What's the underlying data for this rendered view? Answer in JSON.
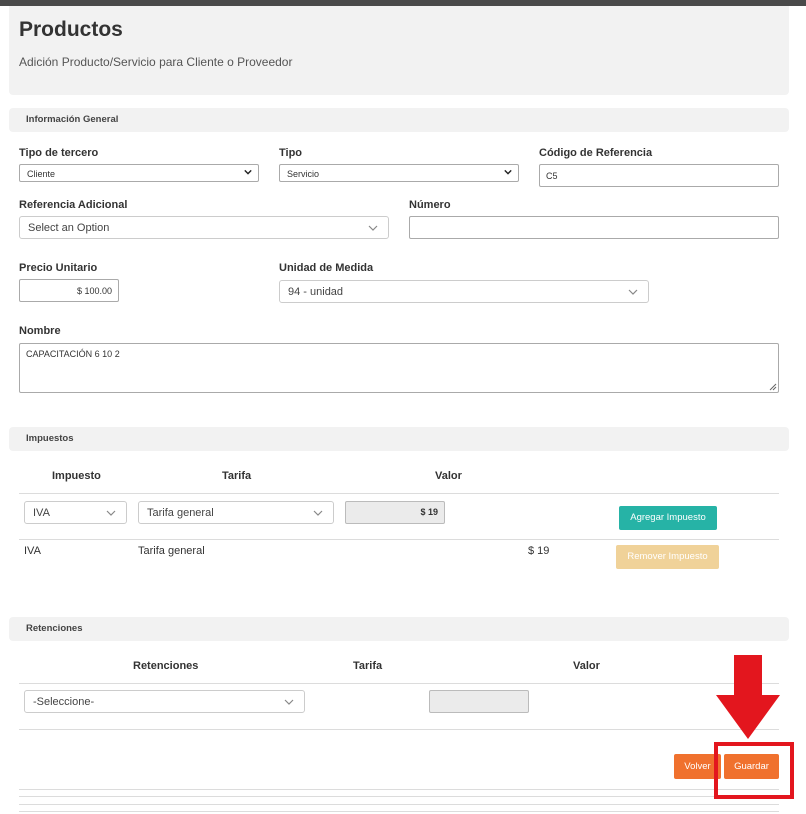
{
  "header": {
    "title": "Productos",
    "subtitle": "Adición Producto/Servicio para Cliente o Proveedor"
  },
  "general": {
    "section_title": "Información General",
    "tipo_tercero": {
      "label": "Tipo de tercero",
      "value": "Cliente"
    },
    "tipo": {
      "label": "Tipo",
      "value": "Servicio"
    },
    "codigo_referencia": {
      "label": "Código de Referencia",
      "value": "C5"
    },
    "referencia_adicional": {
      "label": "Referencia Adicional",
      "value": "Select an Option"
    },
    "numero": {
      "label": "Número",
      "value": ""
    },
    "precio_unitario": {
      "label": "Precio Unitario",
      "value": "$ 100.00"
    },
    "unidad_medida": {
      "label": "Unidad de Medida",
      "value": "94 - unidad"
    },
    "nombre": {
      "label": "Nombre",
      "value": "CAPACITACIÓN 6 10 2"
    }
  },
  "impuestos": {
    "section_title": "Impuestos",
    "columns": [
      "Impuesto",
      "Tarifa",
      "Valor"
    ],
    "new_row": {
      "impuesto": "IVA",
      "tarifa": "Tarifa general",
      "valor": "$ 19",
      "add_label": "Agregar Impuesto"
    },
    "rows": [
      {
        "impuesto": "IVA",
        "tarifa": "Tarifa general",
        "valor": "$ 19",
        "remove_label": "Remover Impuesto"
      }
    ]
  },
  "retenciones": {
    "section_title": "Retenciones",
    "columns": [
      "Retenciones",
      "Tarifa",
      "Valor"
    ],
    "new_row": {
      "retencion": "-Seleccione-"
    }
  },
  "actions": {
    "back_label": "Volver",
    "save_label": "Guardar"
  },
  "colors": {
    "teal": "#26b3a6",
    "disabled_orange": "#f0d299",
    "orange": "#f0712e",
    "annotation_red": "#e3161e"
  }
}
